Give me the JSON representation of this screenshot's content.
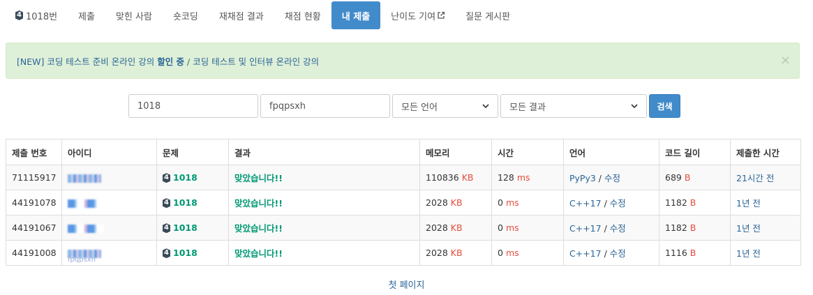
{
  "nav": {
    "problem_tier": "4",
    "items": [
      {
        "label": "1018번"
      },
      {
        "label": "제출"
      },
      {
        "label": "맞힌 사람"
      },
      {
        "label": "숏코딩"
      },
      {
        "label": "재채점 결과"
      },
      {
        "label": "채점 현황"
      },
      {
        "label": "내 제출"
      },
      {
        "label": "난이도 기여"
      },
      {
        "label": "질문 게시판"
      }
    ],
    "active_index": 6
  },
  "alert": {
    "prefix": "[NEW] 코딩 테스트 준비 온라인 강의 ",
    "highlight": "할인 중",
    "separator": " / ",
    "link2": "코딩 테스트 및 인터뷰 온라인 강의",
    "close": "×"
  },
  "search": {
    "problem_id": "1018",
    "user_id": "fpqpsxh",
    "language": "모든 언어",
    "result": "모든 결과",
    "button": "검색"
  },
  "table": {
    "headers": [
      "제출 번호",
      "아이디",
      "문제",
      "결과",
      "메모리",
      "시간",
      "언어",
      "코드 길이",
      "제출한 시간"
    ],
    "rows": [
      {
        "id": "71115917",
        "tier": "4",
        "problem": "1018",
        "result": "맞았습니다!!",
        "memory": "110836",
        "memory_unit": "KB",
        "time": "128",
        "time_unit": "ms",
        "lang": "PyPy3",
        "edit": "수정",
        "code_len": "689",
        "code_unit": "B",
        "submitted": "21시간 전"
      },
      {
        "id": "44191078",
        "tier": "4",
        "problem": "1018",
        "result": "맞았습니다!!",
        "memory": "2028",
        "memory_unit": "KB",
        "time": "0",
        "time_unit": "ms",
        "lang": "C++17",
        "edit": "수정",
        "code_len": "1182",
        "code_unit": "B",
        "submitted": "1년 전"
      },
      {
        "id": "44191067",
        "tier": "4",
        "problem": "1018",
        "result": "맞았습니다!!",
        "memory": "2028",
        "memory_unit": "KB",
        "time": "0",
        "time_unit": "ms",
        "lang": "C++17",
        "edit": "수정",
        "code_len": "1182",
        "code_unit": "B",
        "submitted": "1년 전"
      },
      {
        "id": "44191008",
        "tier": "4",
        "problem": "1018",
        "result": "맞았습니다!!",
        "memory": "2028",
        "memory_unit": "KB",
        "time": "0",
        "time_unit": "ms",
        "lang": "C++17",
        "edit": "수정",
        "code_len": "1116",
        "code_unit": "B",
        "submitted": "1년 전"
      }
    ],
    "faint_uid": "fpqpsxh"
  },
  "pager": {
    "first_page": "첫 페이지"
  },
  "colors": {
    "accent": "#428bca",
    "accepted": "#009874",
    "unit": "#e74c3c",
    "link": "#2a6496",
    "alert_bg": "#dff0d8"
  }
}
